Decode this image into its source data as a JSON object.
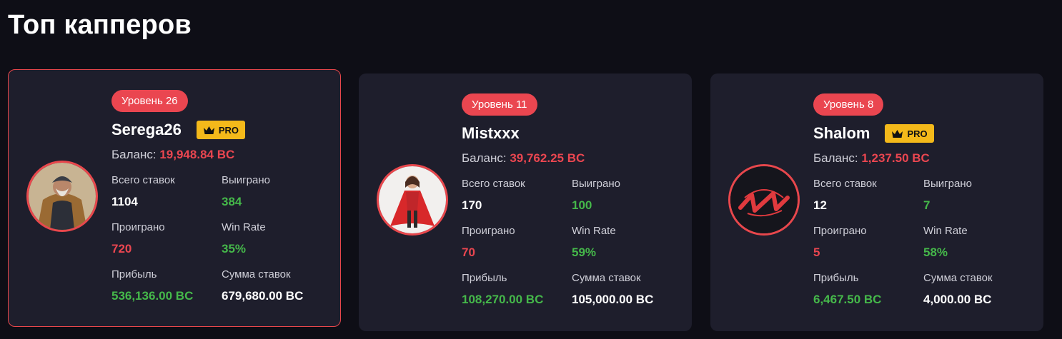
{
  "page": {
    "title": "Топ капперов"
  },
  "labels": {
    "balance": "Баланс:",
    "total_bets": "Всего ставок",
    "won": "Выиграно",
    "lost": "Проиграно",
    "win_rate": "Win Rate",
    "profit": "Прибыль",
    "bets_sum": "Сумма ставок",
    "pro": "PRO"
  },
  "cappers": [
    {
      "level": "Уровень 26",
      "name": "Serega26",
      "pro": true,
      "balance": "19,948.84 BC",
      "total_bets": "1104",
      "won": "384",
      "lost": "720",
      "win_rate": "35%",
      "profit": "536,136.00 BC",
      "bets_sum": "679,680.00 BC"
    },
    {
      "level": "Уровень 11",
      "name": "Mistxxx",
      "pro": false,
      "balance": "39,762.25 BC",
      "total_bets": "170",
      "won": "100",
      "lost": "70",
      "win_rate": "59%",
      "profit": "108,270.00 BC",
      "bets_sum": "105,000.00 BC"
    },
    {
      "level": "Уровень 8",
      "name": "Shalom",
      "pro": true,
      "balance": "1,237.50 BC",
      "total_bets": "12",
      "won": "7",
      "lost": "5",
      "win_rate": "58%",
      "profit": "6,467.50 BC",
      "bets_sum": "4,000.00 BC"
    }
  ],
  "colors": {
    "accent_red": "#ea4650",
    "pro_gold": "#f4b91a",
    "positive_green": "#45b84a",
    "card_bg": "#1e1e2c",
    "page_bg": "#0e0e16"
  }
}
